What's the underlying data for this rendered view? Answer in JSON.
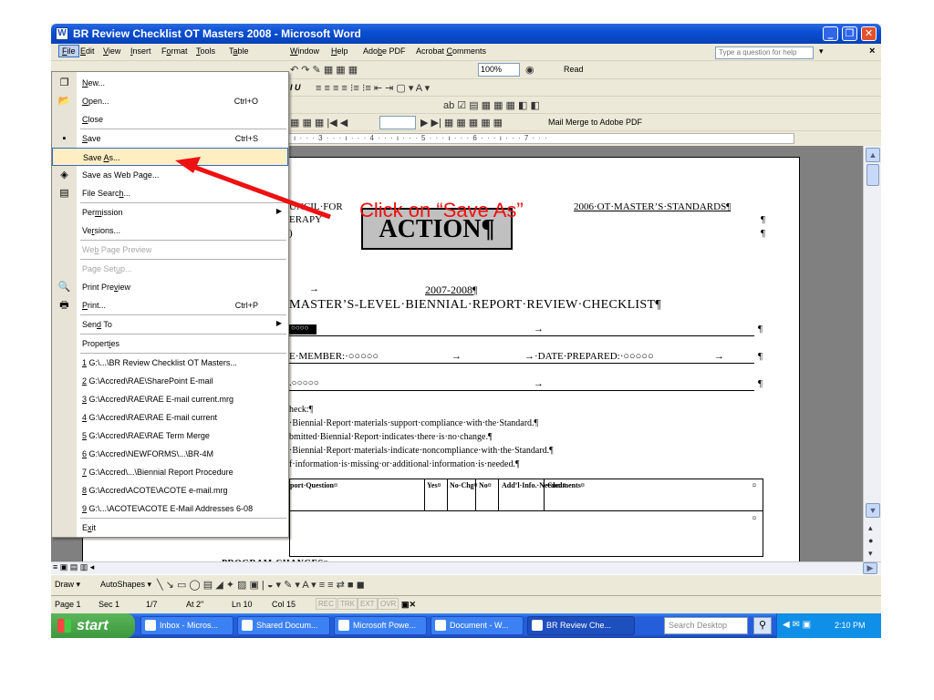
{
  "window": {
    "title": "BR Review Checklist OT Masters 2008 - Microsoft Word",
    "caption_buttons": [
      "_",
      "❐",
      "✕"
    ]
  },
  "menubar": {
    "items": [
      {
        "pre": "",
        "key": "F",
        "post": "ile"
      },
      {
        "pre": "",
        "key": "E",
        "post": "dit"
      },
      {
        "pre": "",
        "key": "V",
        "post": "iew"
      },
      {
        "pre": "",
        "key": "I",
        "post": "nsert"
      },
      {
        "pre": "F",
        "key": "o",
        "post": "rmat"
      },
      {
        "pre": "",
        "key": "T",
        "post": "ools"
      },
      {
        "pre": "T",
        "key": "a",
        "post": "ble"
      },
      {
        "pre": "",
        "key": "W",
        "post": "indow"
      },
      {
        "pre": "",
        "key": "H",
        "post": "elp"
      },
      {
        "pre": "Ado",
        "key": "b",
        "post": "e PDF"
      },
      {
        "pre": "Acrobat ",
        "key": "C",
        "post": "omments"
      }
    ],
    "help_placeholder": "Type a question for help",
    "help_arrow": "▾",
    "close_glyph": "×"
  },
  "toolbar": {
    "zoom": "100%",
    "read_label": "Read",
    "mail_merge_label": "Mail Merge to Adobe PDF",
    "font_buttons": "I  U"
  },
  "ruler": {
    "marks": "· · · 2 · · · ı · · · 3 · · · ı · · · 4 · · · ı · · · 5 · · · ı · · · 6 · · · ı · · · 7 · · ·"
  },
  "annotation": {
    "text": "Click on “Save As”"
  },
  "file_menu": {
    "items": [
      {
        "pre": "",
        "key": "N",
        "post": "ew...",
        "shortcut": "",
        "icon": "❐",
        "disabled": false,
        "highlight": false,
        "submenu": false
      },
      {
        "pre": "",
        "key": "O",
        "post": "pen...",
        "shortcut": "Ctrl+O",
        "icon": "📂",
        "disabled": false,
        "highlight": false,
        "submenu": false
      },
      {
        "pre": "",
        "key": "C",
        "post": "lose",
        "shortcut": "",
        "icon": "",
        "disabled": false,
        "highlight": false,
        "submenu": false
      },
      {
        "pre": "",
        "key": "S",
        "post": "ave",
        "shortcut": "Ctrl+S",
        "icon": "▪",
        "disabled": false,
        "highlight": false,
        "submenu": false
      },
      {
        "pre": "Save ",
        "key": "A",
        "post": "s...",
        "shortcut": "",
        "icon": "",
        "disabled": false,
        "highlight": true,
        "submenu": false
      },
      {
        "pre": "Save as Web Pa",
        "key": "g",
        "post": "e...",
        "shortcut": "",
        "icon": "◈",
        "disabled": false,
        "highlight": false,
        "submenu": false
      },
      {
        "pre": "File Searc",
        "key": "h",
        "post": "...",
        "shortcut": "",
        "icon": "▤",
        "disabled": false,
        "highlight": false,
        "submenu": false
      },
      {
        "pre": "Per",
        "key": "m",
        "post": "ission",
        "shortcut": "",
        "icon": "",
        "disabled": false,
        "highlight": false,
        "submenu": true
      },
      {
        "pre": "Ve",
        "key": "r",
        "post": "sions...",
        "shortcut": "",
        "icon": "",
        "disabled": false,
        "highlight": false,
        "submenu": false
      },
      {
        "pre": "We",
        "key": "b",
        "post": " Page Preview",
        "shortcut": "",
        "icon": "",
        "disabled": true,
        "highlight": false,
        "submenu": false
      },
      {
        "pre": "Page Set",
        "key": "u",
        "post": "p...",
        "shortcut": "",
        "icon": "",
        "disabled": true,
        "highlight": false,
        "submenu": false
      },
      {
        "pre": "Print Pre",
        "key": "v",
        "post": "iew",
        "shortcut": "",
        "icon": "🔍",
        "disabled": false,
        "highlight": false,
        "submenu": false
      },
      {
        "pre": "",
        "key": "P",
        "post": "rint...",
        "shortcut": "Ctrl+P",
        "icon": "🖶",
        "disabled": false,
        "highlight": false,
        "submenu": false
      },
      {
        "pre": "Sen",
        "key": "d",
        "post": " To",
        "shortcut": "",
        "icon": "",
        "disabled": false,
        "highlight": false,
        "submenu": true
      },
      {
        "pre": "Propert",
        "key": "i",
        "post": "es",
        "shortcut": "",
        "icon": "",
        "disabled": false,
        "highlight": false,
        "submenu": false
      },
      {
        "pre": "",
        "key": "1",
        "post": " G:\\...\\BR Review Checklist OT Masters...",
        "shortcut": "",
        "icon": "",
        "disabled": false,
        "highlight": false,
        "submenu": false
      },
      {
        "pre": "",
        "key": "2",
        "post": " G:\\Accred\\RAE\\SharePoint E-mail",
        "shortcut": "",
        "icon": "",
        "disabled": false,
        "highlight": false,
        "submenu": false
      },
      {
        "pre": "",
        "key": "3",
        "post": " G:\\Accred\\RAE\\RAE E-mail current.mrg",
        "shortcut": "",
        "icon": "",
        "disabled": false,
        "highlight": false,
        "submenu": false
      },
      {
        "pre": "",
        "key": "4",
        "post": " G:\\Accred\\RAE\\RAE E-mail current",
        "shortcut": "",
        "icon": "",
        "disabled": false,
        "highlight": false,
        "submenu": false
      },
      {
        "pre": "",
        "key": "5",
        "post": " G:\\Accred\\RAE\\RAE Term Merge",
        "shortcut": "",
        "icon": "",
        "disabled": false,
        "highlight": false,
        "submenu": false
      },
      {
        "pre": "",
        "key": "6",
        "post": " G:\\Accred\\NEWFORMS\\...\\BR-4M",
        "shortcut": "",
        "icon": "",
        "disabled": false,
        "highlight": false,
        "submenu": false
      },
      {
        "pre": "",
        "key": "7",
        "post": " G:\\Accred\\...\\Biennial Report Procedure",
        "shortcut": "",
        "icon": "",
        "disabled": false,
        "highlight": false,
        "submenu": false
      },
      {
        "pre": "",
        "key": "8",
        "post": " G:\\Accred\\ACOTE\\ACOTE e-mail.mrg",
        "shortcut": "",
        "icon": "",
        "disabled": false,
        "highlight": false,
        "submenu": false
      },
      {
        "pre": "",
        "key": "9",
        "post": " G:\\...\\ACOTE\\ACOTE E-Mail Addresses 6-08",
        "shortcut": "",
        "icon": "",
        "disabled": false,
        "highlight": false,
        "submenu": false
      },
      {
        "pre": "E",
        "key": "x",
        "post": "it",
        "shortcut": "",
        "icon": "",
        "disabled": false,
        "highlight": false,
        "submenu": false
      }
    ]
  },
  "document": {
    "council_line": "UNCIL·FOR",
    "therapy_line": "ERAPY",
    "paren_line": ")",
    "standards": "2006·OT·MASTER’S·STANDARDS¶",
    "pilcrow": "¶",
    "action": "ACTION¶",
    "arrow": "→",
    "year": "2007-2008¶",
    "heading": "MASTER’S-LEVEL·BIENNIAL·REPORT·REVIEW·CHECKLIST¶",
    "field_dots": "○○○○",
    "member_label": "E·MEMBER:·○○○○○",
    "date_label": "→·DATE·PREPARED:·○○○○○",
    "dots_line": ".○○○○○",
    "check_heading": "heck:¶",
    "check1": "·Biennial·Report·materials·support·compliance·with·the·Standard.¶",
    "check2": "bmitted·Biennial·Report·indicates·there·is·no·change.¶",
    "check3": "·Biennial·Report·materials·indicate·noncompliance·with·the·Standard.¶",
    "check4": "f·information·is·missing·or·additional·information·is·needed.¶",
    "table_headers": [
      "port·Question¤",
      "Yes¤",
      "No·Chg¤",
      "No¤",
      "Add’l·Info.·Needed¤",
      "Comments¤"
    ],
    "cell_marker": "¤",
    "program_changes": "PROGRAM·CHANGES¤"
  },
  "drawbar": {
    "draw": "Draw ▾",
    "autoshapes": "AutoShapes ▾"
  },
  "statusbar": {
    "page": "Page 1",
    "sec": "Sec 1",
    "pages": "1/7",
    "at": "At 2\"",
    "ln": "Ln 10",
    "col": "Col 15",
    "modes": [
      "REC",
      "TRK",
      "EXT",
      "OVR"
    ]
  },
  "taskbar": {
    "start": "start",
    "tasks": [
      "Inbox - Micros...",
      "Shared Docum...",
      "Microsoft Powe...",
      "Document - W...",
      "BR Review Che..."
    ],
    "search_placeholder": "Search Desktop",
    "clock": "2:10 PM"
  },
  "colors": {
    "annotation": "#ee1111",
    "highlight": "#ffeec2",
    "titlebar": "#0a4fd4"
  }
}
